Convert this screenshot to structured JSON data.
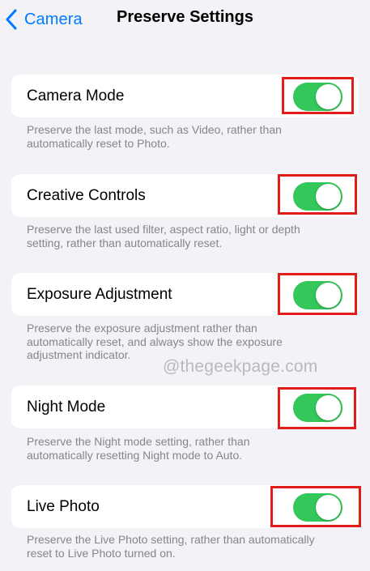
{
  "nav": {
    "back_label": "Camera",
    "title": "Preserve Settings"
  },
  "settings": [
    {
      "label": "Camera Mode",
      "enabled": true,
      "footer": [
        "Preserve the last mode, such as Video, rather than",
        "automatically reset to Photo."
      ]
    },
    {
      "label": "Creative Controls",
      "enabled": true,
      "footer": [
        "Preserve the last used filter, aspect ratio, light or depth",
        "setting, rather than automatically reset."
      ]
    },
    {
      "label": "Exposure Adjustment",
      "enabled": true,
      "footer": [
        "Preserve the exposure adjustment rather than",
        "automatically reset, and always show the exposure",
        "adjustment indicator."
      ]
    },
    {
      "label": "Night Mode",
      "enabled": true,
      "footer": [
        "Preserve the Night mode setting, rather than",
        "automatically resetting Night mode to Auto."
      ]
    },
    {
      "label": "Live Photo",
      "enabled": true,
      "footer": [
        "Preserve the Live Photo setting, rather than automatically",
        "reset to Live Photo turned on."
      ]
    }
  ],
  "watermark": "@thegeekpage.com",
  "colors": {
    "accent": "#007aff",
    "toggle_on": "#34c759",
    "highlight": "#e21b1b",
    "background": "#f2f2f7",
    "footer_text": "#85858b"
  },
  "icons": {
    "back": "chevron-left-icon"
  }
}
